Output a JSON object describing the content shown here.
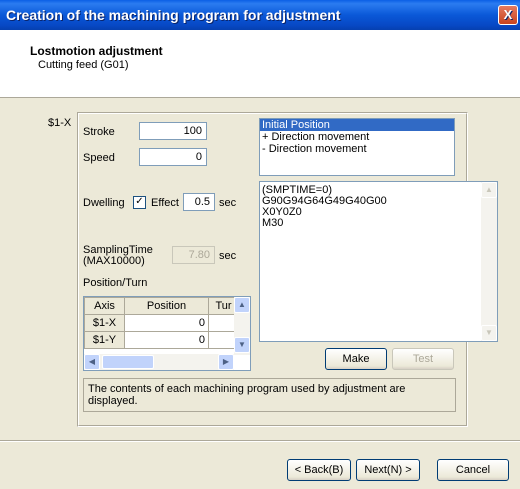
{
  "window": {
    "title": "Creation of the machining program for adjustment",
    "close_glyph": "X"
  },
  "header": {
    "title": "Lostmotion adjustment",
    "subtitle": "Cutting feed (G01)"
  },
  "axis_label": "$1-X",
  "fields": {
    "stroke_label": "Stroke",
    "stroke_value": "100",
    "speed_label": "Speed",
    "speed_value": "0",
    "dwelling_label": "Dwelling",
    "dwelling_check_label": "Effect",
    "dwelling_checked": true,
    "dwelling_value": "0.5",
    "dwelling_unit": "sec",
    "sampling_label_line1": "SamplingTime",
    "sampling_label_line2": "(MAX10000)",
    "sampling_value": "7.80",
    "sampling_unit": "sec",
    "position_turn_label": "Position/Turn"
  },
  "position_table": {
    "headers": [
      "Axis",
      "Position",
      "Tur"
    ],
    "rows": [
      {
        "axis": "$1-X",
        "position": "0",
        "turn": ""
      },
      {
        "axis": "$1-Y",
        "position": "0",
        "turn": ""
      }
    ]
  },
  "movement_list": {
    "items": [
      "Initial Position",
      "+ Direction movement",
      "- Direction movement"
    ],
    "selected": 0
  },
  "program_text": [
    "(SMPTIME=0)",
    "G90G94G64G49G40G00",
    "X0Y0Z0",
    "M30"
  ],
  "buttons": {
    "make": "Make",
    "test": "Test",
    "back": "< Back(B)",
    "next": "Next(N) >",
    "cancel": "Cancel"
  },
  "message": "The contents of each machining program used by adjustment are displayed."
}
